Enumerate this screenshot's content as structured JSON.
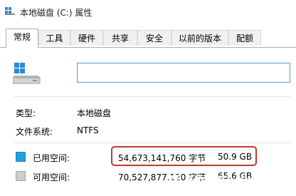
{
  "window": {
    "title": "本地磁盘 (C:) 属性"
  },
  "tabs": [
    {
      "label": "常规",
      "active": true
    },
    {
      "label": "工具",
      "active": false
    },
    {
      "label": "硬件",
      "active": false
    },
    {
      "label": "共享",
      "active": false
    },
    {
      "label": "安全",
      "active": false
    },
    {
      "label": "以前的版本",
      "active": false
    },
    {
      "label": "配额",
      "active": false
    }
  ],
  "general": {
    "name_value": "",
    "type_label": "类型:",
    "type_value": "本地磁盘",
    "fs_label": "文件系统:",
    "fs_value": "NTFS"
  },
  "space": {
    "used": {
      "label": "已用空间:",
      "bytes": "54,673,141,760 字节",
      "size": "50.9 GB",
      "color": "#26a0da"
    },
    "free": {
      "label": "可用空间:",
      "bytes": "70,527,877,120 字节",
      "size": "65.6 GB",
      "color": "#cdcdcd"
    }
  },
  "highlight_color": "#c0392b",
  "watermark_text": "系统天地"
}
